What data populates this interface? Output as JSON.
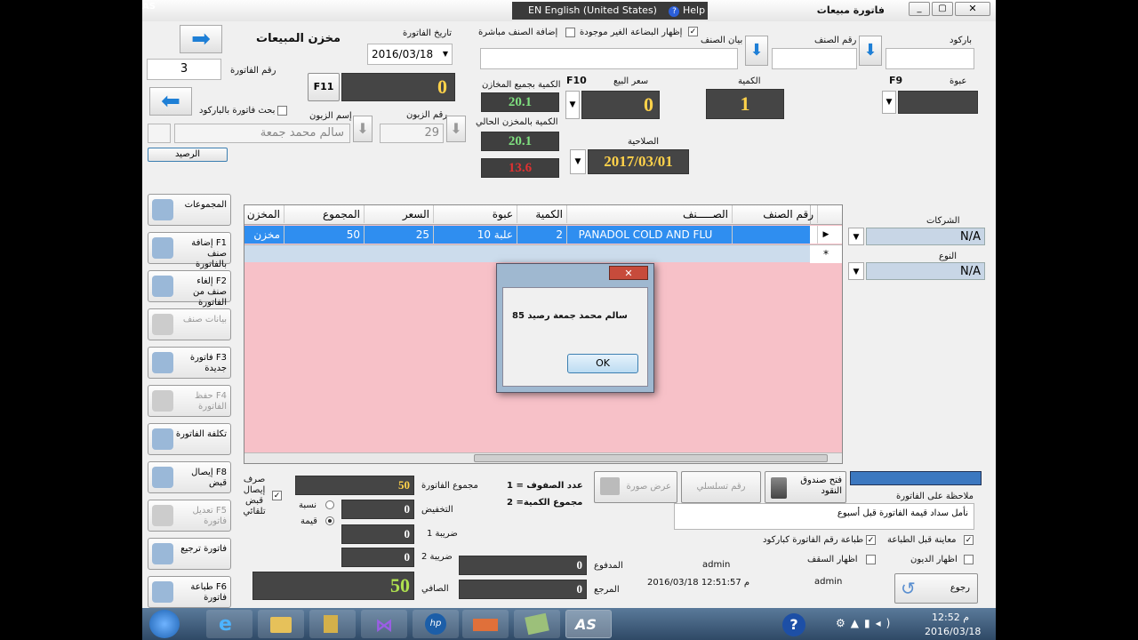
{
  "window": {
    "title": "فاتورة مبيعات",
    "lang": "EN English (United States)",
    "help": "Help"
  },
  "header": {
    "store_title": "مخزن المبيعات",
    "invoice_no_label": "رقم الفاتورة",
    "invoice_no": "3",
    "invoice_date_label": "تاريخ الفاتورة",
    "invoice_date": "2016/03/18",
    "f11": "F11",
    "total_display": "0",
    "show_missing_label": "إظهار البضاعة الغير موجودة",
    "add_direct_label": "إضافة الصنف مباشرة",
    "barcode_label": "باركود",
    "item_no_label": "رقم الصنف",
    "item_data_label": "بيان الصنف",
    "qty_all_label": "الكمية بجميع المخازن",
    "qty_all": "20.1",
    "qty_cur_label": "الكمية بالمخزن الحالي",
    "qty_cur": "20.1",
    "qty_red": "13.6",
    "sale_price_label": "سعر البيع",
    "f10": "F10",
    "sale_price": "0",
    "qty_label": "الكمية",
    "qty": "1",
    "pack_label": "عبوة",
    "f9": "F9",
    "expiry_label": "الصلاحية",
    "expiry": "2017/03/01",
    "cust_no_label": "رقم الزبون",
    "cust_no": "29",
    "cust_name_label": "إسم الزبون",
    "cust_name": "سالم محمد جمعة",
    "barcode_search_label": "بحث فاتورة بالباركود",
    "balance_btn": "الرصيد"
  },
  "right_panel": {
    "companies_label": "الشركات",
    "companies": "N/A",
    "type_label": "النوع",
    "type": "N/A"
  },
  "sidebar": [
    {
      "label": "المجموعات",
      "disabled": false
    },
    {
      "label": "F1 إضافة صنف بالفاتورة",
      "disabled": false
    },
    {
      "label": "F2 إلغاء صنف من الفاتورة",
      "disabled": false
    },
    {
      "label": "بيانات صنف",
      "disabled": true
    },
    {
      "label": "F3 فاتورة جديدة",
      "disabled": false
    },
    {
      "label": "F4 حفظ الفاتورة",
      "disabled": true
    },
    {
      "label": "تكلفة الفاتورة",
      "disabled": false
    },
    {
      "label": "F8 إيصال قبض",
      "disabled": false
    },
    {
      "label": "F5 تعديل فاتورة",
      "disabled": true
    },
    {
      "label": "فاتورة ترجيع",
      "disabled": false
    },
    {
      "label": "F6 طباعة فاتورة",
      "disabled": false
    }
  ],
  "grid": {
    "columns": [
      "رقم الصنف",
      "الصـــــنف",
      "الكمية",
      "عبوة",
      "السعر",
      "المجموع",
      "المخزن"
    ],
    "rows": [
      [
        "",
        "PANADOL COLD AND FLU",
        "2",
        "علبة 10",
        "25",
        "50",
        "مخزن"
      ]
    ]
  },
  "dialog": {
    "message": "سالم محمد جمعة رصيد 85",
    "ok": "OK"
  },
  "totals": {
    "auto_receipt_label": "صرف إيصال قبض تلقائي",
    "percent_label": "نسبة",
    "value_label": "قيمة",
    "invoice_total_label": "مجموع الفاتورة",
    "invoice_total": "50",
    "discount_label": "التخفيض",
    "discount": "0",
    "tax1_label": "ضريبة 1",
    "tax1": "0",
    "tax2_label": "ضريبة 2",
    "tax2": "0",
    "net_label": "الصافي",
    "net": "50",
    "rows_count": "عدد الصفوف = 1",
    "qty_sum": "مجموع الكمية= 2",
    "paid_label": "المدفوع",
    "paid": "0",
    "returned_label": "المرجع",
    "returned": "0",
    "show_image": "عرض صورة",
    "serial_no": "رقم تسلسلي",
    "open_drawer": "فتح صندوق النقود",
    "note_label": "ملاحظة على الفاتورة",
    "note": "نأمل سداد قيمة الفاتورة قبل أسبوع",
    "preview_label": "معاينة قبل الطباعة",
    "print_barcode_label": "طباعة رقم الفاتورة كباركود",
    "show_debts_label": "اظهار الديون",
    "show_ceiling_label": "اظهار السقف",
    "user1": "admin",
    "user2": "admin",
    "timestamp": "2016/03/18 12:51:57 م",
    "back_btn": "رجوع"
  },
  "taskbar": {
    "time": "12:52 م",
    "date": "2016/03/18"
  }
}
